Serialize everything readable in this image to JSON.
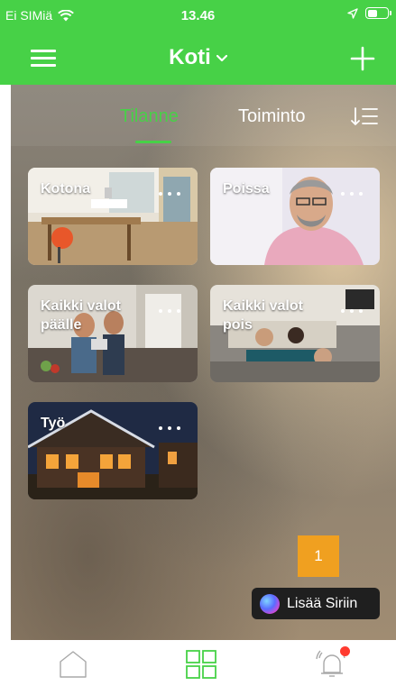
{
  "status": {
    "carrier": "Ei SIMiä",
    "time": "13.46",
    "battery_level": 0.55
  },
  "nav": {
    "title": "Koti",
    "menu_icon": "hamburger-menu-icon",
    "add_icon": "plus-icon"
  },
  "tabs": {
    "active": "Tilanne",
    "inactive": "Toiminto",
    "sort_icon": "sort-list-icon"
  },
  "scenes": [
    {
      "label": "Kotona",
      "more": "···"
    },
    {
      "label": "Poissa",
      "more": "···"
    },
    {
      "label": "Kaikki valot päälle",
      "more": "···"
    },
    {
      "label": "Kaikki valot pois",
      "more": "···"
    },
    {
      "label": "Työ",
      "more": "···"
    }
  ],
  "badge": "1",
  "siri": {
    "label": "Lisää Siriin"
  },
  "bottom_tabs": [
    {
      "icon": "home-icon"
    },
    {
      "icon": "grid-icon"
    },
    {
      "icon": "alarm-bell-icon",
      "has_notification": true
    }
  ],
  "colors": {
    "brand_green": "#47d147",
    "notification_red": "#ff3b30",
    "badge_orange": "#f0a020"
  }
}
